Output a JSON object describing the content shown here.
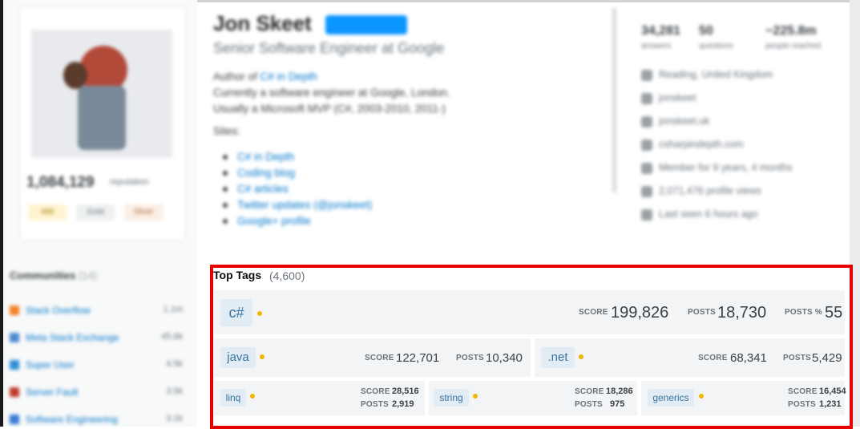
{
  "profile": {
    "name": "Jon Skeet",
    "mod_badge": "",
    "title": "Senior Software Engineer at Google",
    "about_lines": [
      "Author of ",
      "C# in Depth",
      "Currently a software engineer at Google, London.",
      "Usually a Microsoft MVP (C#, 2003-2010, 2011-)"
    ],
    "sites_title": "Sites:",
    "sites": [
      "C# in Depth",
      "Coding blog",
      "C# articles",
      "Twitter updates (@jonskeet)",
      "Google+ profile"
    ]
  },
  "sidebar": {
    "reputation": "1,084,129",
    "reputation_label": "reputation",
    "badges": [
      "496",
      "Gold",
      "Silver"
    ],
    "communities_title": "Communities",
    "communities_count": "(14)",
    "communities": [
      {
        "name": "Stack Overflow",
        "count": "1.1m"
      },
      {
        "name": "Meta Stack Exchange",
        "count": "45.6k"
      },
      {
        "name": "Super User",
        "count": "4.5k"
      },
      {
        "name": "Server Fault",
        "count": "3.5k"
      },
      {
        "name": "Software Engineering",
        "count": "3.1k"
      }
    ]
  },
  "stats": {
    "answers": "34,281",
    "answers_label": "answers",
    "questions": "50",
    "questions_label": "questions",
    "reached": "~225.8m",
    "reached_label": "people reached",
    "location": "Reading, United Kingdom",
    "twitter": "jonskeet",
    "website": "jonskeet.uk",
    "email": "csharpindepth.com",
    "member_for": "Member for 9 years, 4 months",
    "profile_views": "2,071,476 profile views",
    "last_seen": "Last seen 6 hours ago"
  },
  "top_tags": {
    "title": "Top Tags",
    "count": "(4,600)",
    "score_label": "SCORE",
    "posts_label": "POSTS",
    "posts_pct_label": "POSTS %",
    "tags": [
      {
        "name": "c#",
        "score": "199,826",
        "posts": "18,730",
        "posts_pct": "55"
      },
      {
        "name": "java",
        "score": "122,701",
        "posts": "10,340"
      },
      {
        "name": ".net",
        "score": "68,341",
        "posts": "5,429"
      },
      {
        "name": "linq",
        "score": "28,516",
        "posts": "2,919"
      },
      {
        "name": "string",
        "score": "18,286",
        "posts": "975"
      },
      {
        "name": "generics",
        "score": "16,454",
        "posts": "1,231"
      }
    ]
  },
  "colors": {
    "highlight": "#e60000",
    "tag_bg": "#e1ecf4",
    "tag_text": "#39739d",
    "gold_dot": "#f1b600",
    "link": "#0077cc"
  }
}
